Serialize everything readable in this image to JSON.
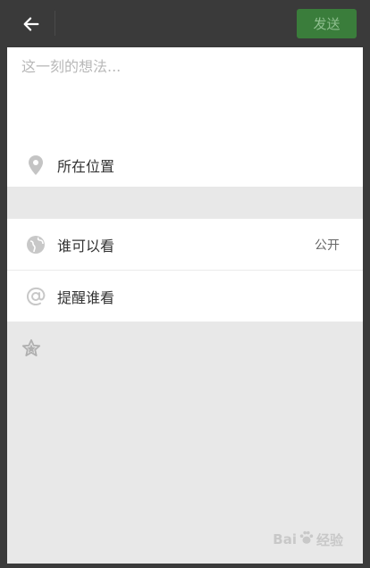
{
  "topbar": {
    "back_icon": "arrow-left-icon",
    "send_label": "发送",
    "send_color": "#3a7d3b"
  },
  "compose": {
    "placeholder": "这一刻的想法..."
  },
  "location": {
    "icon": "location-pin-icon",
    "label": "所在位置"
  },
  "options": [
    {
      "icon": "globe-icon",
      "label": "谁可以看",
      "value": "公开"
    },
    {
      "icon": "at-sign-icon",
      "label": "提醒谁看"
    }
  ],
  "extra": {
    "icon": "star-icon"
  },
  "watermark": {
    "text_left": "Bai",
    "text_right": "经验",
    "icon": "baidu-paw-icon"
  }
}
